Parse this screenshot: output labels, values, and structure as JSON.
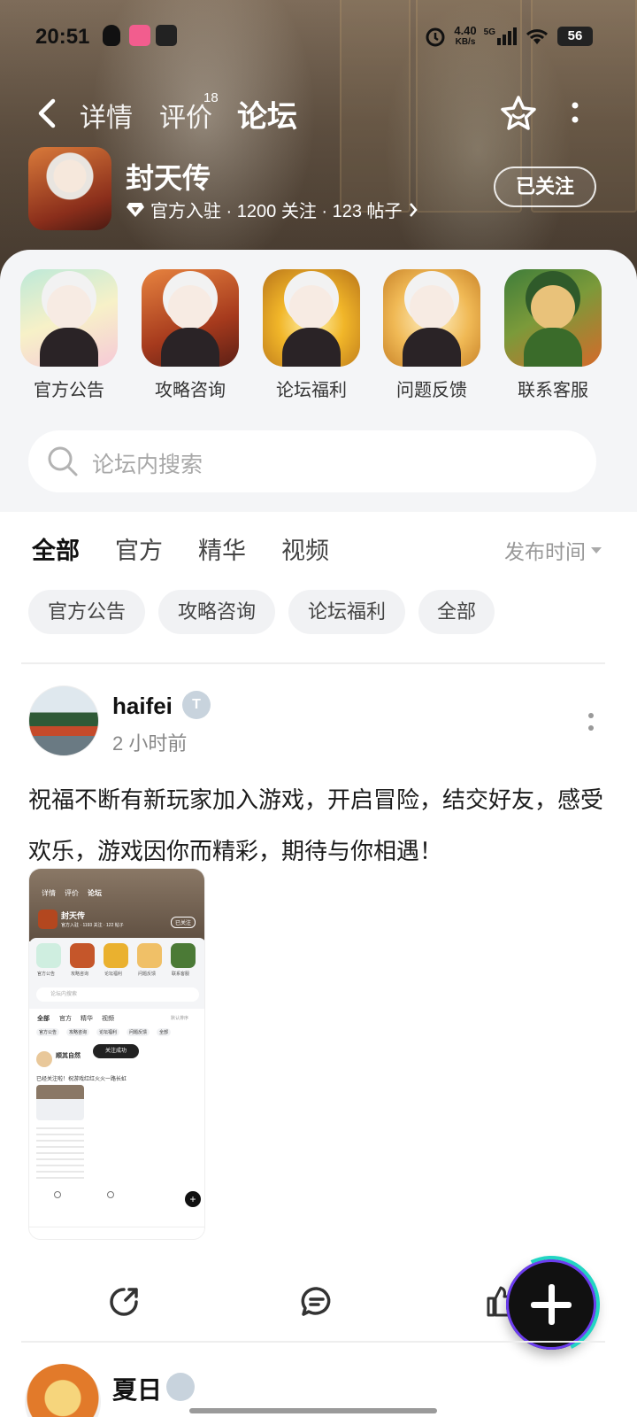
{
  "status_bar": {
    "time": "20:51",
    "speed": "4.40",
    "speed_unit": "KB/s",
    "network": "5G",
    "battery": "56"
  },
  "nav": {
    "tabs": [
      {
        "label": "详情"
      },
      {
        "label": "评价",
        "badge": "18"
      },
      {
        "label": "论坛"
      }
    ],
    "active_tab": "论坛"
  },
  "game": {
    "name": "封天传",
    "meta": "官方入驻 · 1200 关注 · 123 帖子",
    "follow_label": "已关注"
  },
  "shortcuts": [
    {
      "label": "官方公告"
    },
    {
      "label": "攻略咨询"
    },
    {
      "label": "论坛福利"
    },
    {
      "label": "问题反馈"
    },
    {
      "label": "联系客服"
    }
  ],
  "search": {
    "placeholder": "论坛内搜索"
  },
  "filter_tabs": [
    "全部",
    "官方",
    "精华",
    "视频"
  ],
  "sort_label": "发布时间",
  "chips": [
    "官方公告",
    "攻略咨询",
    "论坛福利",
    "全部"
  ],
  "post": {
    "author": "haifei",
    "time": "2 小时前",
    "text": "祝福不断有新玩家加入游戏，开启冒险，结交好友，感受欢乐，游戏因你而精彩，期待与你相遇！",
    "image": {
      "game_name": "封天传",
      "meta": "官方入驻 · 1193 关注 · 122 帖子",
      "follow": "已关注",
      "tabs": [
        "详情",
        "评价",
        "论坛"
      ],
      "shortcuts": [
        "官方公告",
        "攻略咨询",
        "论坛福利",
        "问题反馈",
        "联系客服"
      ],
      "search": "论坛内搜索",
      "filter_tabs": [
        "全部",
        "官方",
        "精华",
        "视频"
      ],
      "sort": "默认排序",
      "chips": [
        "官方公告",
        "攻略咨询",
        "论坛福利",
        "问题反馈",
        "全部"
      ],
      "author": "顺其自然",
      "toast": "关注成功",
      "text": "已经关注啦！祝游戏红红火火一路长虹"
    }
  },
  "next_post": {
    "author": "夏日"
  }
}
